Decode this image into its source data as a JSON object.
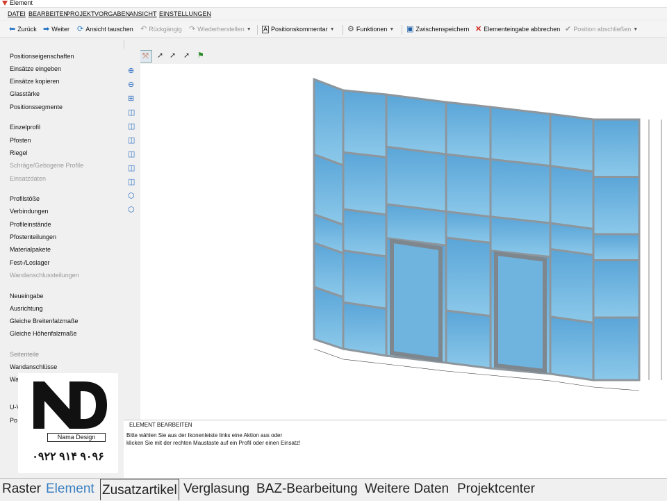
{
  "window": {
    "title": "Element"
  },
  "menu": [
    "DATEI",
    "BEARBEITEN",
    "PROJEKT",
    "VORGABEN",
    "ANSICHT",
    "EINSTELLUNGEN"
  ],
  "toolbar": {
    "back": "Zurück",
    "forward": "Weiter",
    "swap_view": "Ansicht tauschen",
    "undo": "Rückgängig",
    "redo": "Wiederherstellen",
    "position_comment": "Positionskommentar",
    "functions": "Funktionen",
    "save_temp": "Zwischenspeichern",
    "cancel_element": "Elementeingabe abbrechen",
    "finish_position": "Position abschließen"
  },
  "sidebar": {
    "items": [
      {
        "label": "Positionseigenschaften",
        "enabled": true
      },
      {
        "label": "Einsätze eingeben",
        "enabled": true
      },
      {
        "label": "Einsätze kopieren",
        "enabled": true
      },
      {
        "label": "Glasstärke",
        "enabled": true
      },
      {
        "label": "Positionssegmente",
        "enabled": true
      },
      {
        "label": "Einzelprofil",
        "enabled": true
      },
      {
        "label": "Pfosten",
        "enabled": true
      },
      {
        "label": "Riegel",
        "enabled": true
      },
      {
        "label": "Schräge/Gebogene Profile",
        "enabled": false
      },
      {
        "label": "Einsatzdaten",
        "enabled": false
      },
      {
        "label": "Profilstöße",
        "enabled": true
      },
      {
        "label": "Verbindungen",
        "enabled": true
      },
      {
        "label": "Profileinstände",
        "enabled": true
      },
      {
        "label": "Pfostenteilungen",
        "enabled": true
      },
      {
        "label": "Materialpakete",
        "enabled": true
      },
      {
        "label": "Fest-/Loslager",
        "enabled": true
      },
      {
        "label": "Wandanschlussteilungen",
        "enabled": false
      },
      {
        "label": "Neueingabe",
        "enabled": true
      },
      {
        "label": "Ausrichtung",
        "enabled": true
      },
      {
        "label": "Gleiche Breitenfalzmaße",
        "enabled": true
      },
      {
        "label": "Gleiche Höhenfalzmaße",
        "enabled": true
      },
      {
        "label": "Seitenteile",
        "enabled": false
      },
      {
        "label": "Wandanschlüsse",
        "enabled": true
      },
      {
        "label": "Wa",
        "enabled": true
      },
      {
        "label": "U-V",
        "enabled": true
      },
      {
        "label": "Po",
        "enabled": true
      }
    ]
  },
  "logo": {
    "brand": "Nama Design",
    "phone": "۰۹۲۲ ۹۱۴ ۹۰۹۶"
  },
  "message": {
    "title": "ELEMENT BEARBEITEN",
    "text_line1": "Bitte wählen Sie aus der Ikonenleiste links eine Aktion aus oder",
    "text_line2": "klicken Sie mit der rechten Maustaste auf ein Profil oder einen Einsatz!"
  },
  "tabs": [
    "Raster",
    "Element",
    "Zusatzartikel",
    "Verglasung",
    "BAZ-Bearbeitung",
    "Weitere Daten",
    "Projektcenter"
  ],
  "active_tab": "Element",
  "colors": {
    "glass": "#5fa6d6",
    "frame": "#a9b3bb",
    "accent": "#3a7fc0"
  }
}
